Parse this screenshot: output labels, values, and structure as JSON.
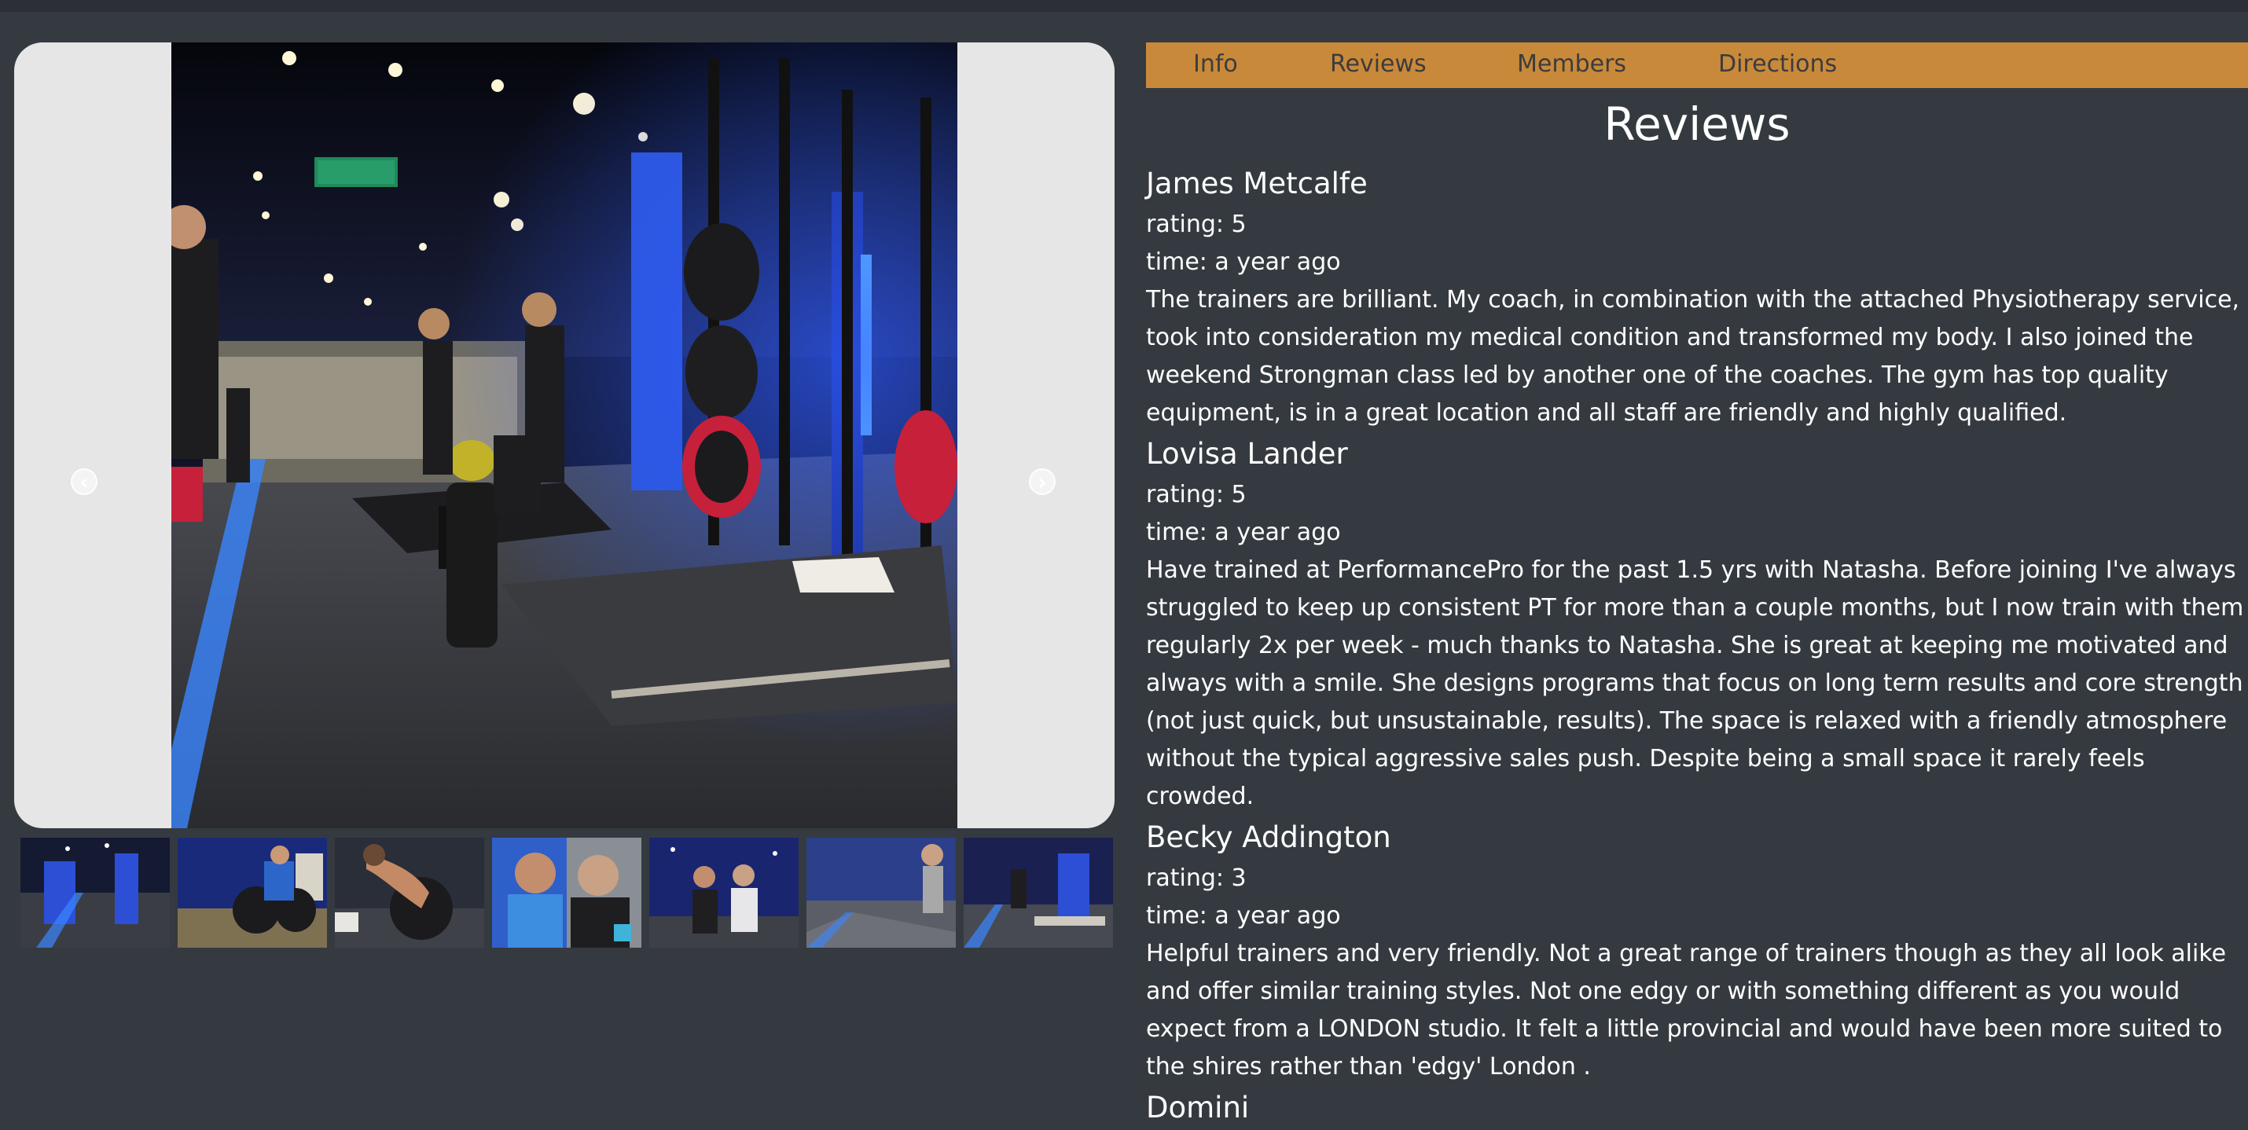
{
  "tabs": [
    "Info",
    "Reviews",
    "Members",
    "Directions"
  ],
  "heading": "Reviews",
  "carousel": {
    "prev_icon": "chevron-left-icon",
    "next_icon": "chevron-right-icon"
  },
  "reviews": [
    {
      "author": "James Metcalfe",
      "rating": "rating: 5",
      "time": "time: a year ago",
      "text": "The trainers are brilliant. My coach, in combination with the attached Physiotherapy service, took into consideration my medical condition and transformed my body. I also joined the weekend Strongman class led by another one of the coaches. The gym has top quality equipment, is in a great location and all staff are friendly and highly qualified."
    },
    {
      "author": "Lovisa Lander",
      "rating": "rating: 5",
      "time": "time: a year ago",
      "text": "Have trained at PerformancePro for the past 1.5 yrs with Natasha. Before joining I've always struggled to keep up consistent PT for more than a couple months, but I now train with them regularly 2x per week - much thanks to Natasha. She is great at keeping me motivated and always with a smile. She designs programs that focus on long term results and core strength (not just quick, but unsustainable, results). The space is relaxed with a friendly atmosphere without the typical aggressive sales push. Despite being a small space it rarely feels crowded."
    },
    {
      "author": "Becky Addington",
      "rating": "rating: 3",
      "time": "time: a year ago",
      "text": "Helpful trainers and very friendly. Not a great range of trainers though as they all look alike and offer similar training styles. Not one edgy or with something different as you would expect from a LONDON studio. It felt a little provincial and would have been more suited to the shires rather than 'edgy' London ."
    },
    {
      "author": "Domini",
      "rating": "",
      "time": "",
      "text": ""
    }
  ],
  "colors": {
    "background": "#353a40",
    "tab_bar": "#c9893a",
    "carousel_bg": "#e6e6e6",
    "accent_blue": "#2f5bff"
  }
}
